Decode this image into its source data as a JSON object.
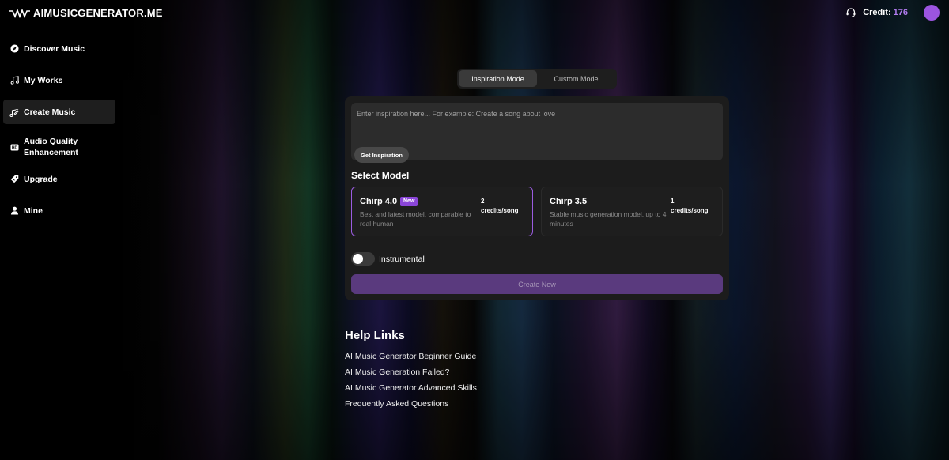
{
  "header": {
    "logo_text": "AIMUSICGENERATOR.ME",
    "credit_label": "Credit:",
    "credit_value": "176",
    "accent": "#9c55e0"
  },
  "sidebar": {
    "items": [
      {
        "label": "Discover Music",
        "icon": "compass-icon"
      },
      {
        "label": "My Works",
        "icon": "music-note-icon"
      },
      {
        "label": "Create Music",
        "icon": "music-create-icon",
        "active": true
      },
      {
        "label": "Audio Quality Enhancement",
        "icon": "hd-icon"
      },
      {
        "label": "Upgrade",
        "icon": "tag-icon"
      },
      {
        "label": "Mine",
        "icon": "user-icon"
      }
    ]
  },
  "modes": {
    "inspiration": "Inspiration Mode",
    "custom": "Custom Mode",
    "active": "inspiration"
  },
  "inspiration": {
    "placeholder": "Enter inspiration here... For example: Create a song about love",
    "value": "",
    "get_inspiration_label": "Get Inspiration"
  },
  "models": {
    "title": "Select Model",
    "cards": [
      {
        "name": "Chirp 4.0",
        "badge": "New",
        "description": "Best and latest model, comparable to real human",
        "credits_line1": "2",
        "credits_line2": "credits/song",
        "selected": true
      },
      {
        "name": "Chirp 3.5",
        "description": "Stable music generation model, up to 4 minutes",
        "credits_line1": "1",
        "credits_line2": "credits/song",
        "selected": false
      }
    ]
  },
  "instrumental": {
    "label": "Instrumental",
    "enabled": false
  },
  "create_button": "Create Now",
  "help": {
    "title": "Help Links",
    "links": [
      "AI Music Generator Beginner Guide",
      "AI Music Generation Failed?",
      "AI Music Generator Advanced Skills",
      "Frequently Asked Questions"
    ]
  }
}
